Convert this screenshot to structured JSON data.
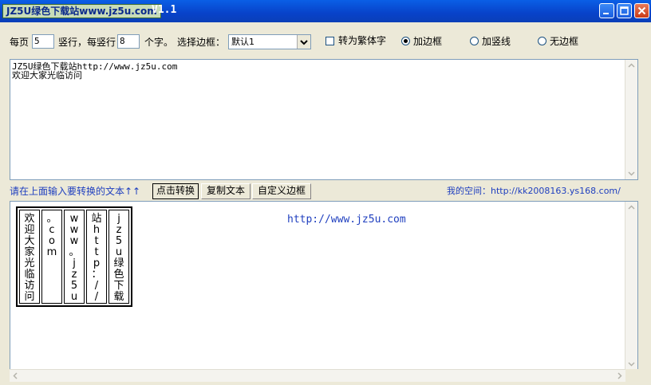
{
  "window": {
    "title": "JZ5U绿色下载站www.jz5u.com",
    "version": "V1.1"
  },
  "toolbar": {
    "per_page_label": "每页",
    "per_page_value": "5",
    "cols_label": "竖行，每竖行",
    "per_col_value": "8",
    "chars_label": "个字。",
    "border_label": "选择边框：",
    "border_select_value": "默认1",
    "traditional_label": "转为繁体字",
    "radio_add_border": "加边框",
    "radio_add_vline": "加竖线",
    "radio_no_border": "无边框"
  },
  "input_text": "JZ5U绿色下载站http://www.jz5u.com\n欢迎大家光临访问",
  "midbar": {
    "hint": "请在上面输入要转换的文本↑↑",
    "convert_button": "点击转换",
    "copy_button": "复制文本",
    "custom_border_button": "自定义边框",
    "my_space": "我的空间：http://kk2008163.ys168.com/"
  },
  "output": {
    "columns": [
      [
        "欢",
        "迎",
        "大",
        "家",
        "光",
        "临",
        "访",
        "问"
      ],
      [
        "。",
        "c",
        "o",
        "m"
      ],
      [
        "w",
        "w",
        "w",
        "。",
        "j",
        "z",
        "5",
        "u"
      ],
      [
        "站",
        "h",
        "t",
        "t",
        "p",
        "：",
        "/",
        "/"
      ],
      [
        "j",
        "z",
        "5",
        "u",
        "绿",
        "色",
        "下",
        "载"
      ]
    ],
    "url_text": "http://www.jz5u.com"
  }
}
